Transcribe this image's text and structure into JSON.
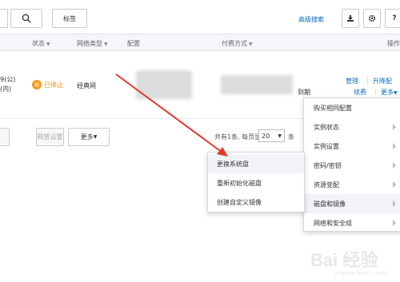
{
  "toolbar": {
    "tag_label": "标签",
    "advanced_search": "高级搜索"
  },
  "table": {
    "headers": {
      "status": "状态",
      "network_type": "网络类型",
      "config": "配置",
      "billing": "付费方式",
      "actions": "操作"
    }
  },
  "row": {
    "ip_fragment_line1": "9(公)",
    "ip_fragment_line2": "(内)",
    "status": "已停止",
    "network": "经典网",
    "expire_text": "到期",
    "actions": {
      "manage": "管理",
      "upgrade": "升降配",
      "renew": "续费",
      "more": "更多"
    }
  },
  "footer": {
    "release_settings": "释放设置",
    "more": "更多",
    "pager_prefix": "共有1条, 每页显示:",
    "page_size": "20",
    "pager_suffix": "条"
  },
  "menu": {
    "items": [
      {
        "label": "购买相同配置",
        "has_submenu": false
      },
      {
        "label": "实例状态",
        "has_submenu": true
      },
      {
        "label": "实例设置",
        "has_submenu": true
      },
      {
        "label": "密码/密钥",
        "has_submenu": true
      },
      {
        "label": "资源变配",
        "has_submenu": true
      },
      {
        "label": "磁盘和镜像",
        "has_submenu": true
      },
      {
        "label": "网络和安全组",
        "has_submenu": true
      }
    ]
  },
  "submenu": {
    "items": [
      {
        "label": "更换系统盘"
      },
      {
        "label": "重新初始化磁盘"
      },
      {
        "label": "创建自定义镜像"
      }
    ]
  },
  "watermark": {
    "main": "Bai 经验",
    "sub": "jingyan.baidu.com"
  },
  "colors": {
    "link": "#0f6cbf",
    "stopped": "#f38f12",
    "arrow": "#e03a2f"
  }
}
